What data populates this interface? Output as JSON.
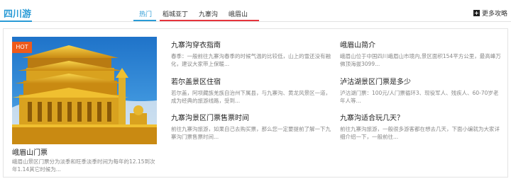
{
  "header": {
    "title": "四川游",
    "tabs": [
      "热门",
      "稻城亚丁",
      "九寨沟",
      "峨眉山"
    ],
    "more_label": "更多攻略"
  },
  "feature": {
    "badge": "HOT",
    "title": "峨眉山门票",
    "desc": "峨眉山景区门票分为淡季和旺季淡季时间为每年的12.15到次年1.14其它时候为..."
  },
  "articles": [
    {
      "title": "九寨沟穿衣指南",
      "desc": "春季：一般前往九寨沟春季的时候气温的比较低，山上的雪还没有融化，建议大家带上保暖..."
    },
    {
      "title": "若尔盖景区住宿",
      "desc": "若尔盖，阿坝藏族羌族自治州下属县，与九寨沟、黄龙风景区一道，成为经典的旅游线路，受到..."
    },
    {
      "title": "九寨沟景区门票售票时间",
      "desc": "前往九寨沟旅游，如果自己去购买票，那么您一定要提前了解一下九寨沟门票售票时间..."
    },
    {
      "title": "峨眉山简介",
      "desc": "峨眉山位于中国四川峨眉山市境内,景区面积154平方公里，最高峰万佛顶海拔3099..."
    },
    {
      "title": "泸沽湖景区门票是多少",
      "desc": "泸沽湖门票：100元/人门票循环3、现役军人、残疾人、60-70岁老年人等..."
    },
    {
      "title": "九寨沟适合玩几天？",
      "desc": "前往九寨沟旅游，一般很多游客都在想去几天，下面小编就为大家详细介绍一下，一般前往..."
    }
  ],
  "colors": {
    "accent": "#2a9bd6",
    "red_underline": "#e6343c",
    "hot_badge": "#ee5a1b"
  }
}
